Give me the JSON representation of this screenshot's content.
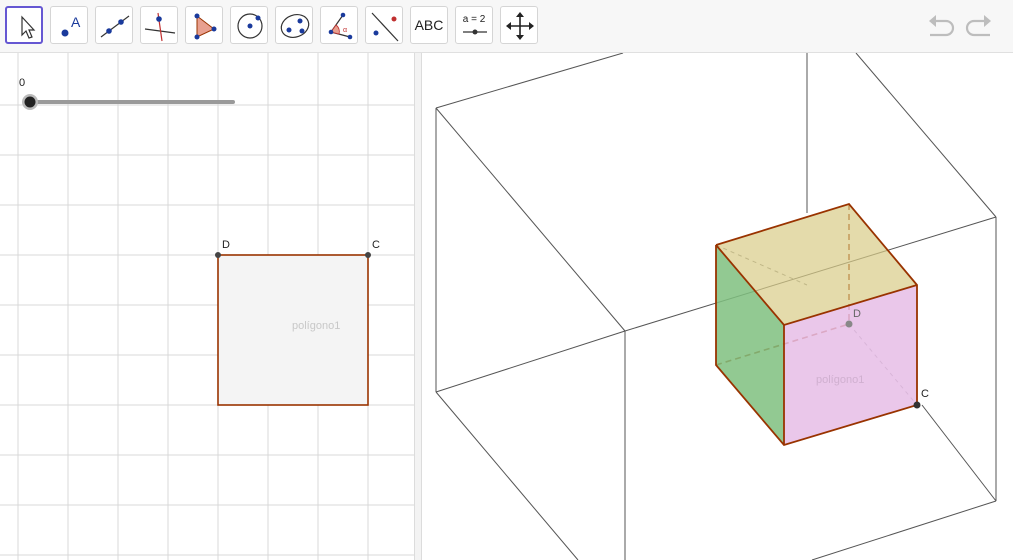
{
  "toolbar": {
    "tools": [
      {
        "name": "move-tool",
        "active": true
      },
      {
        "name": "point-tool"
      },
      {
        "name": "line-tool"
      },
      {
        "name": "perpendicular-line-tool"
      },
      {
        "name": "polygon-tool"
      },
      {
        "name": "circle-tool"
      },
      {
        "name": "conic-tool"
      },
      {
        "name": "angle-tool"
      },
      {
        "name": "reflect-tool"
      },
      {
        "name": "text-tool",
        "label": "ABC"
      },
      {
        "name": "slider-tool",
        "label": "a = 2"
      },
      {
        "name": "move-graphics-view-tool"
      }
    ],
    "undo_icon": "undo-icon",
    "redo_icon": "redo-icon"
  },
  "graphics": {
    "slider": {
      "label": "0",
      "value": 0,
      "min": 0,
      "max": 1
    },
    "point_d": "D",
    "point_c": "C",
    "polygon_label": "polígono1"
  },
  "view3d": {
    "point_d": "D",
    "point_c": "C",
    "polygon_label": "polígono1"
  },
  "colors": {
    "accent": "#6557d2",
    "edge": "#993300",
    "top_face": "#d8cc88",
    "left_face": "#7fbf7f",
    "front_face": "#e6bde6",
    "grid": "#d8d8d8"
  }
}
